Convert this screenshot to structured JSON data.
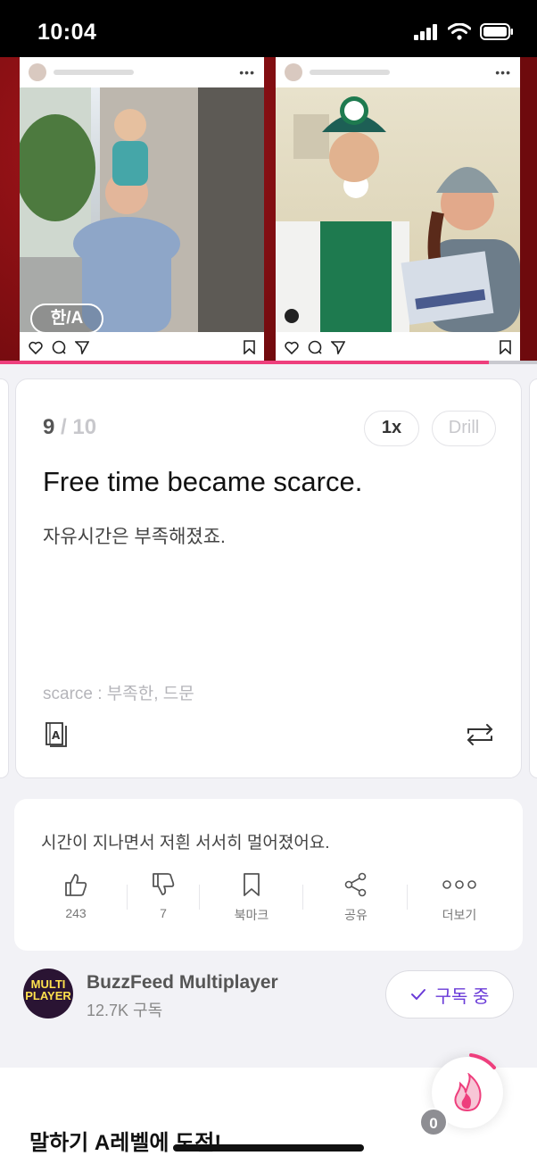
{
  "status_bar": {
    "time": "10:04"
  },
  "video": {
    "translate_toggle": "한/A",
    "progress_fraction": 0.91
  },
  "card": {
    "current_index": "9",
    "total": " / 10",
    "speed_label": "1x",
    "drill_label": "Drill",
    "sentence_en": "Free time became scarce.",
    "sentence_ko": "자유시간은 부족해졌죠.",
    "vocab_note": "scarce : 부족한, 드문"
  },
  "comment": {
    "text": "시간이 지나면서 저흰 서서히 멀어졌어요.",
    "actions": [
      {
        "icon": "thumbs-up-icon",
        "label": "243"
      },
      {
        "icon": "thumbs-down-icon",
        "label": "7"
      },
      {
        "icon": "bookmark-icon",
        "label": "북마크"
      },
      {
        "icon": "share-icon",
        "label": "공유"
      },
      {
        "icon": "more-icon",
        "label": "더보기"
      }
    ]
  },
  "channel": {
    "avatar_text_line1": "MULTI",
    "avatar_text_line2": "PLAYER",
    "name": "BuzzFeed Multiplayer",
    "subscribers": "12.7K 구독",
    "subscribe_label": "구독 중"
  },
  "bottom": {
    "challenge_title": "말하기 A레벨에 도전!",
    "streak_count": "0"
  },
  "colors": {
    "accent": "#ee3f7d",
    "subscribe": "#6a3bd8"
  }
}
